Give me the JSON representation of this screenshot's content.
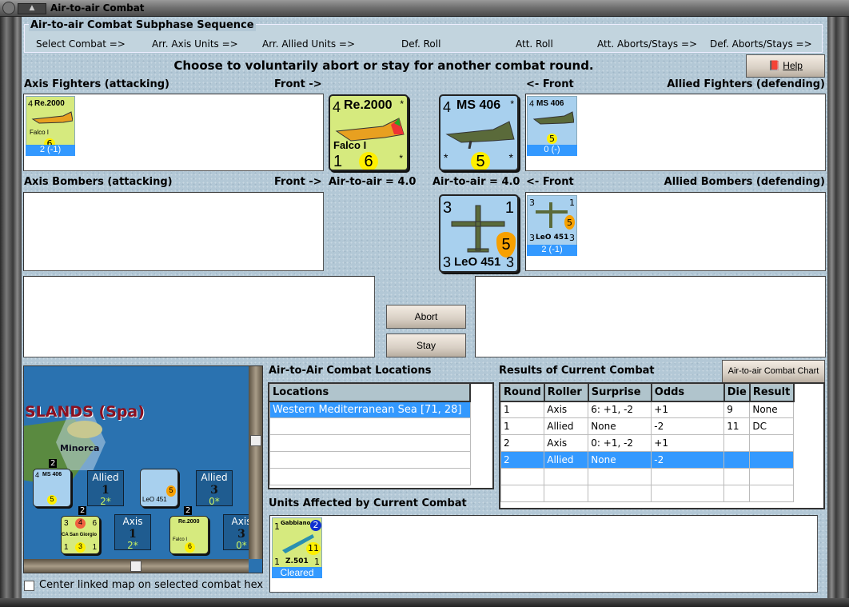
{
  "window": {
    "title": "Air-to-air Combat"
  },
  "subphase": {
    "title": "Air-to-air Combat Subphase Sequence",
    "steps": [
      "Select Combat =>",
      "Arr. Axis Units =>",
      "Arr. Allied Units =>",
      "Def. Roll",
      "Att. Roll",
      "Att. Aborts/Stays =>",
      "Def. Aborts/Stays =>"
    ]
  },
  "instruction": "Choose to voluntarily abort or stay for another combat round.",
  "help_label": "Help",
  "labels": {
    "axis_fighters": "Axis Fighters (attacking)",
    "allied_fighters": "Allied Fighters (defending)",
    "axis_bombers": "Axis Bombers (attacking)",
    "allied_bombers": "Allied Bombers (defending)",
    "front_right": "Front ->",
    "front_left": "<- Front",
    "axis_a2a": "Air-to-air = 4.0",
    "allied_a2a": "Air-to-air = 4.0"
  },
  "units": {
    "re2000": {
      "name": "Re.2000",
      "sub": "Falco I",
      "tl": "4",
      "tr": "*",
      "bl": "1",
      "val": "6",
      "br": "*",
      "status": "2 (-1)"
    },
    "ms406": {
      "name": "MS 406",
      "tl": "4",
      "tr": "*",
      "bl": "*",
      "val": "5",
      "br": "*",
      "status": "0 (-)"
    },
    "leo451": {
      "name": "LeO 451",
      "tl": "3",
      "tr": "1",
      "bl": "3",
      "val": "5",
      "br": "3",
      "status": "2 (-1)"
    },
    "gabbiano": {
      "name": "Gabbiano",
      "type": "Z.501",
      "tl": "1",
      "badge": "2",
      "val": "11",
      "bl": "1",
      "br": "1",
      "status": "Cleared"
    }
  },
  "buttons": {
    "abort": "Abort",
    "stay": "Stay",
    "chart": "Air-to-air Combat Chart"
  },
  "map": {
    "region": "SLANDS (Spa)",
    "island": "Minorca",
    "stacks": [
      {
        "side": "Allied",
        "count": "1",
        "value": "2*"
      },
      {
        "side": "Allied",
        "count": "3",
        "value": "0*"
      },
      {
        "side": "Axis",
        "count": "1",
        "value": "2*"
      },
      {
        "side": "Axis",
        "count": "3",
        "value": "0*"
      }
    ],
    "ship": {
      "class": "CA",
      "name": "San Giorgio",
      "tl": "3",
      "tm": "4",
      "tr": "6",
      "bl": "1",
      "bm": "3",
      "br": "1"
    },
    "stack_badges": [
      "2",
      "2",
      "2"
    ]
  },
  "center_checkbox": {
    "label": "Center linked map on selected combat hex",
    "checked": false
  },
  "locations": {
    "title": "Air-to-Air Combat Locations",
    "header": "Locations",
    "items": [
      "Western Mediterranean Sea [71, 28]"
    ]
  },
  "results": {
    "title": "Results of Current Combat",
    "headers": [
      "Round",
      "Roller",
      "Surprise",
      "Odds",
      "Die",
      "Result"
    ],
    "rows": [
      [
        "1",
        "Axis",
        "6: +1, -2",
        "+1",
        "9",
        "None"
      ],
      [
        "1",
        "Allied",
        "None",
        "-2",
        "11",
        "DC"
      ],
      [
        "2",
        "Axis",
        "0: +1, -2",
        "+1",
        "",
        ""
      ],
      [
        "2",
        "Allied",
        "None",
        "-2",
        "",
        ""
      ]
    ],
    "selected_row": 3
  },
  "affected": {
    "title": "Units Affected by Current Combat"
  }
}
